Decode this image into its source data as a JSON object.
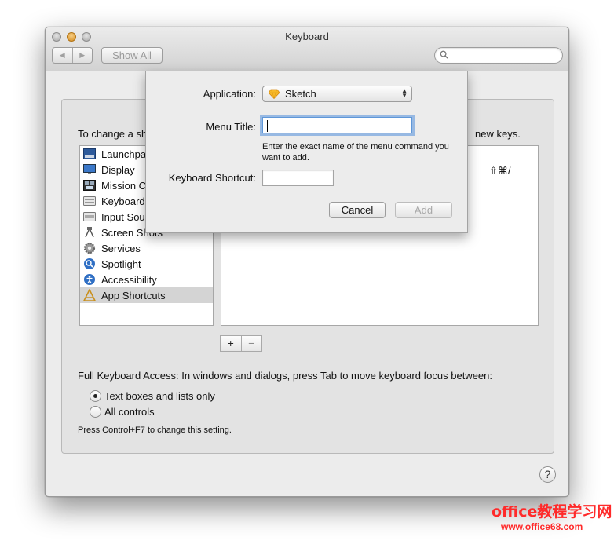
{
  "window": {
    "title": "Keyboard",
    "show_all_label": "Show All",
    "search_placeholder": ""
  },
  "instructions": {
    "left": "To change a shortcut, select it, click",
    "right": "new keys."
  },
  "categories": [
    {
      "label": "Launchpad & Dock",
      "icon": "launchpad-icon"
    },
    {
      "label": "Display",
      "icon": "display-icon"
    },
    {
      "label": "Mission Control",
      "icon": "mission-control-icon"
    },
    {
      "label": "Keyboard",
      "icon": "keyboard-icon"
    },
    {
      "label": "Input Sources",
      "icon": "input-sources-icon"
    },
    {
      "label": "Screen Shots",
      "icon": "screenshot-icon"
    },
    {
      "label": "Services",
      "icon": "gear-icon"
    },
    {
      "label": "Spotlight",
      "icon": "spotlight-icon"
    },
    {
      "label": "Accessibility",
      "icon": "accessibility-icon"
    },
    {
      "label": "App Shortcuts",
      "icon": "app-shortcuts-icon",
      "selected": true
    }
  ],
  "shortcut_list": {
    "visible_shortcut": "⇧⌘/"
  },
  "buttons": {
    "plus": "+",
    "minus": "−"
  },
  "keyboard_access": {
    "label": "Full Keyboard Access: In windows and dialogs, press Tab to move keyboard focus between:",
    "options": [
      "Text boxes and lists only",
      "All controls"
    ],
    "selected_index": 0,
    "hint": "Press Control+F7 to change this setting."
  },
  "help_label": "?",
  "sheet": {
    "application_label": "Application:",
    "application_value": "Sketch",
    "menu_title_label": "Menu Title:",
    "menu_title_value": "",
    "menu_title_help": "Enter the exact name of the menu command you want to add.",
    "keyboard_shortcut_label": "Keyboard Shortcut:",
    "keyboard_shortcut_value": "",
    "cancel_label": "Cancel",
    "add_label": "Add"
  },
  "watermark": {
    "line1": "office教程学习网",
    "line2": "www.office68.com"
  },
  "colors": {
    "focus_ring": "#6a9ede",
    "watermark": "#ff2a2a",
    "selection": "#d4d4d4"
  }
}
